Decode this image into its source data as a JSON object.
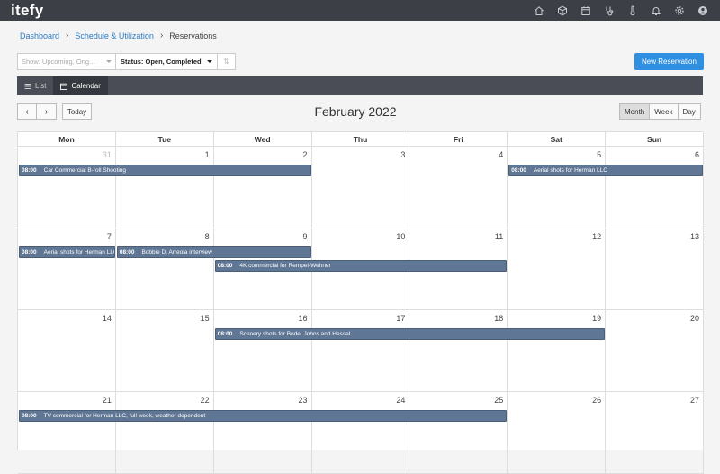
{
  "app": {
    "logo": "itefy"
  },
  "topnav": [
    {
      "icon": "home-icon"
    },
    {
      "icon": "box-icon"
    },
    {
      "icon": "calendar-icon"
    },
    {
      "icon": "stethoscope-icon"
    },
    {
      "icon": "thermometer-icon"
    },
    {
      "icon": "bell-icon"
    },
    {
      "icon": "gear-icon"
    },
    {
      "icon": "user-icon"
    }
  ],
  "breadcrumb": {
    "item1": "Dashboard",
    "item2": "Schedule & Utilization",
    "item3": "Reservations"
  },
  "filters": {
    "show_placeholder": "Show: Upcoming, Ong...",
    "status_value": "Status: Open, Completed",
    "sort_icon": "sort-icon"
  },
  "new_reservation_label": "New Reservation",
  "view_tabs": {
    "list": "List",
    "calendar": "Calendar"
  },
  "calendar": {
    "title": "February 2022",
    "today_label": "Today",
    "prev_icon": "chevron-left-icon",
    "next_icon": "chevron-right-icon",
    "views": {
      "month": "Month",
      "week": "Week",
      "day": "Day"
    },
    "active_view": "Month",
    "weekdays": [
      "Mon",
      "Tue",
      "Wed",
      "Thu",
      "Fri",
      "Sat",
      "Sun"
    ],
    "weeks": [
      [
        {
          "d": "31",
          "other": true
        },
        {
          "d": "1"
        },
        {
          "d": "2"
        },
        {
          "d": "3"
        },
        {
          "d": "4"
        },
        {
          "d": "5"
        },
        {
          "d": "6"
        }
      ],
      [
        {
          "d": "7"
        },
        {
          "d": "8"
        },
        {
          "d": "9"
        },
        {
          "d": "10"
        },
        {
          "d": "11"
        },
        {
          "d": "12"
        },
        {
          "d": "13"
        }
      ],
      [
        {
          "d": "14"
        },
        {
          "d": "15"
        },
        {
          "d": "16"
        },
        {
          "d": "17"
        },
        {
          "d": "18"
        },
        {
          "d": "19"
        },
        {
          "d": "20"
        }
      ],
      [
        {
          "d": "21"
        },
        {
          "d": "22"
        },
        {
          "d": "23"
        },
        {
          "d": "24"
        },
        {
          "d": "25"
        },
        {
          "d": "26"
        },
        {
          "d": "27"
        }
      ]
    ],
    "events": [
      {
        "week": 0,
        "start": 0,
        "end": 2,
        "slot": 0,
        "time": "08:00",
        "title": "Car Commercial B-roll Shooting"
      },
      {
        "week": 0,
        "start": 5,
        "end": 6,
        "slot": 0,
        "time": "08:00",
        "title": "Aerial shots for Herman LLC"
      },
      {
        "week": 1,
        "start": 0,
        "end": 0,
        "slot": 0,
        "time": "08:00",
        "title": "Aerial shots for Herman LLC"
      },
      {
        "week": 1,
        "start": 1,
        "end": 2,
        "slot": 0,
        "time": "08:00",
        "title": "Bobbie D. Arreola interview"
      },
      {
        "week": 1,
        "start": 2,
        "end": 4,
        "slot": 1,
        "time": "08:00",
        "title": "4K commercial for Rempel-Wehner"
      },
      {
        "week": 2,
        "start": 2,
        "end": 5,
        "slot": 0,
        "time": "08:00",
        "title": "Scenery shots for Bode, Johns and Hessel"
      },
      {
        "week": 3,
        "start": 0,
        "end": 4,
        "slot": 0,
        "time": "08:00",
        "title": "TV commercial for Herman LLC, full week, weather dependent"
      }
    ]
  }
}
